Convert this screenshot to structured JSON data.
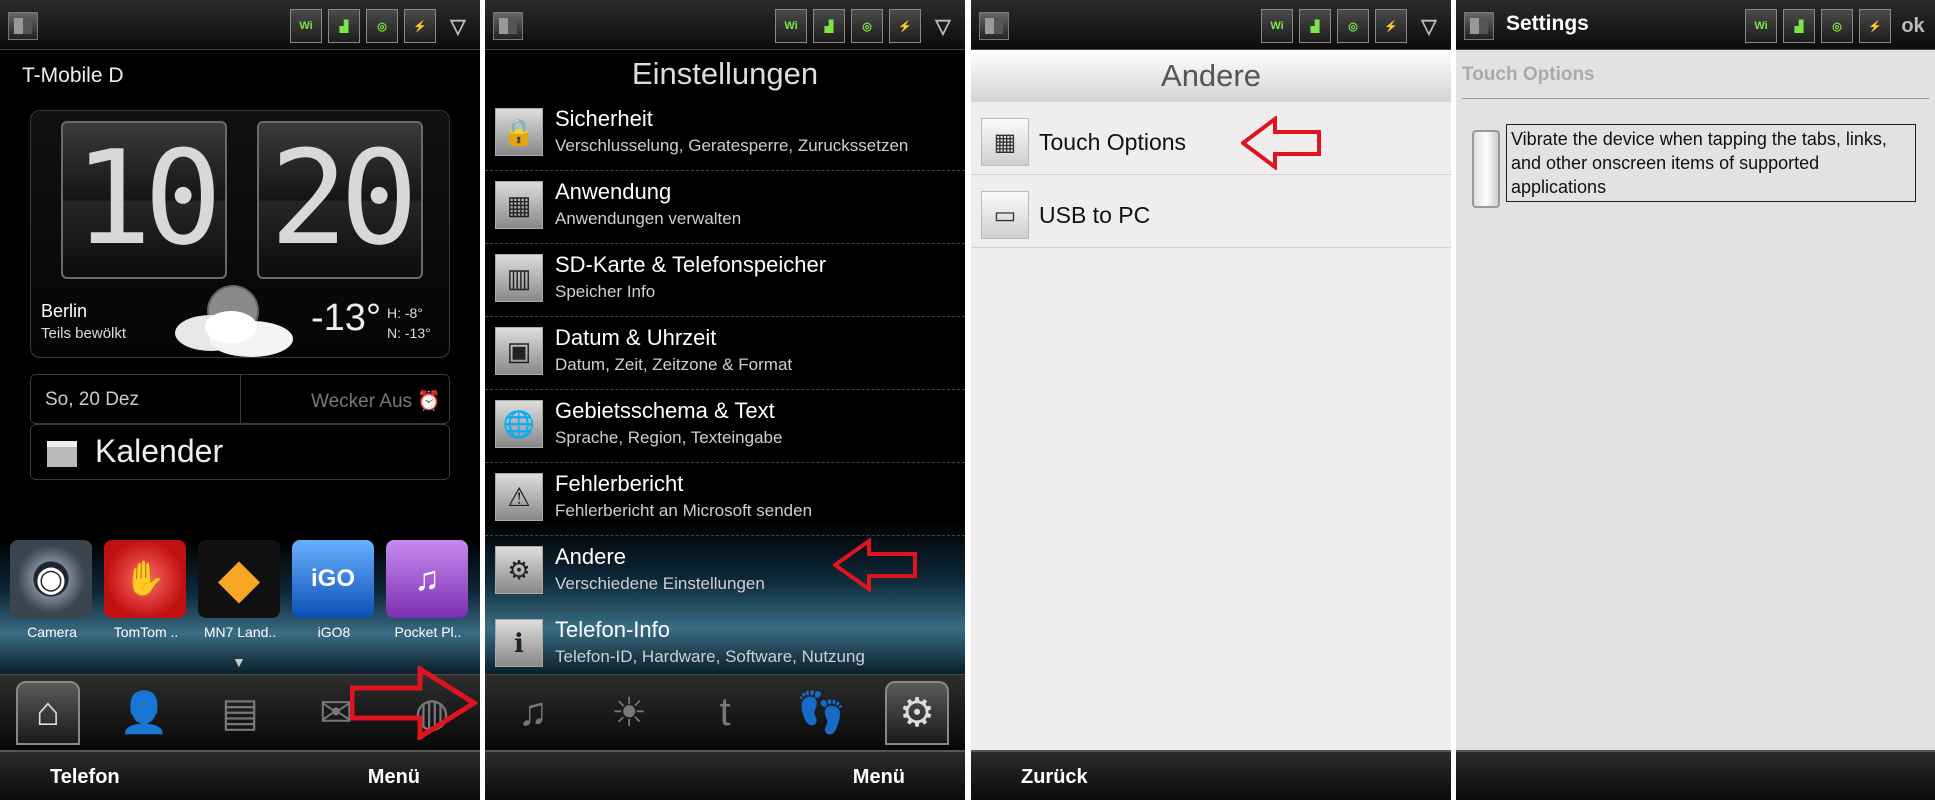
{
  "status_icons": [
    "Wi-Fi",
    "signal",
    "sync",
    "battery",
    "volume"
  ],
  "panel1": {
    "carrier": "T-Mobile D",
    "clock": {
      "hour": "10",
      "minute": "20"
    },
    "weather": {
      "city": "Berlin",
      "condition": "Teils bewölkt",
      "temp": "-13°",
      "high": "H:  -8°",
      "low": "N: -13°"
    },
    "date": "So, 20 Dez",
    "alarm": "Wecker Aus",
    "calendar": "Kalender",
    "apps": [
      {
        "label": "Camera",
        "color": "#3b4550"
      },
      {
        "label": "TomTom ..",
        "color": "#d91a1a"
      },
      {
        "label": "MN7 Land..",
        "color": "#f5a623"
      },
      {
        "label": "iGO8",
        "color": "#1a6ed8"
      },
      {
        "label": "Pocket Pl..",
        "color": "#9b4fd1"
      }
    ],
    "softkeys": {
      "left": "Telefon",
      "right": "Menü"
    }
  },
  "panel2": {
    "title": "Einstellungen",
    "items": [
      {
        "title": "Sicherheit",
        "subtitle": "Verschlusselung, Geratesperre, Zuruckssetzen",
        "icon": "lock-icon"
      },
      {
        "title": "Anwendung",
        "subtitle": "Anwendungen verwalten",
        "icon": "apps-grid-icon"
      },
      {
        "title": "SD-Karte & Telefonspeicher",
        "subtitle": "Speicher Info",
        "icon": "memory-icon"
      },
      {
        "title": "Datum & Uhrzeit",
        "subtitle": "Datum, Zeit, Zeitzone & Format",
        "icon": "calendar-icon"
      },
      {
        "title": "Gebietsschema & Text",
        "subtitle": "Sprache, Region, Texteingabe",
        "icon": "globe-icon"
      },
      {
        "title": "Fehlerbericht",
        "subtitle": "Fehlerbericht an Microsoft senden",
        "icon": "warning-icon"
      },
      {
        "title": "Andere",
        "subtitle": "Verschiedene Einstellungen",
        "icon": "gear-icon"
      },
      {
        "title": "Telefon-Info",
        "subtitle": "Telefon-ID, Hardware, Software, Nutzung",
        "icon": "phone-info-icon"
      }
    ],
    "softkeys": {
      "right": "Menü"
    }
  },
  "panel3": {
    "title": "Andere",
    "items": [
      {
        "label": "Touch Options",
        "icon": "grid-icon"
      },
      {
        "label": "USB to PC",
        "icon": "computer-icon"
      }
    ],
    "softkeys": {
      "left": "Zurück"
    }
  },
  "panel4": {
    "title": "Settings",
    "ok": "ok",
    "section": "Touch Options",
    "option_text": "Vibrate the device when tapping the tabs, links, and other onscreen items of supported applications"
  }
}
